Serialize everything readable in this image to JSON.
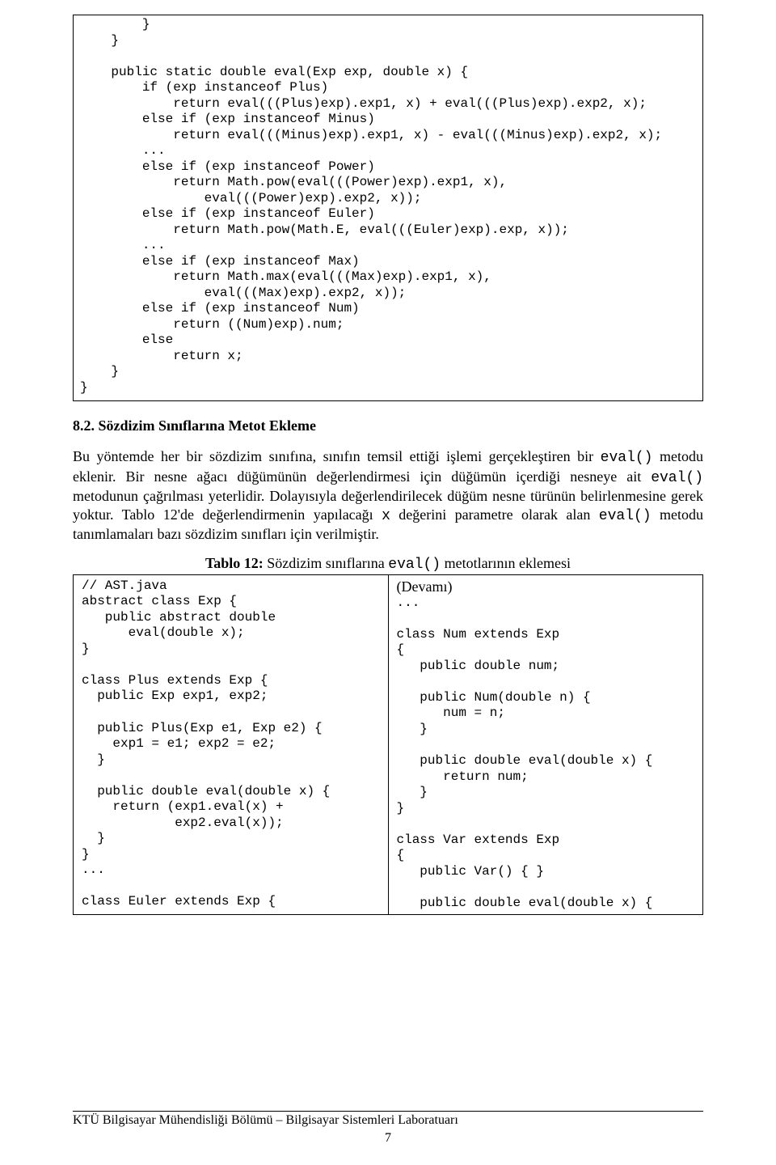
{
  "code_block_1": "        }\n    }\n\n    public static double eval(Exp exp, double x) {\n        if (exp instanceof Plus)\n            return eval(((Plus)exp).exp1, x) + eval(((Plus)exp).exp2, x);\n        else if (exp instanceof Minus)\n            return eval(((Minus)exp).exp1, x) - eval(((Minus)exp).exp2, x);\n        ...\n        else if (exp instanceof Power)\n            return Math.pow(eval(((Power)exp).exp1, x),\n                eval(((Power)exp).exp2, x));\n        else if (exp instanceof Euler)\n            return Math.pow(Math.E, eval(((Euler)exp).exp, x));\n        ...\n        else if (exp instanceof Max)\n            return Math.max(eval(((Max)exp).exp1, x),\n                eval(((Max)exp).exp2, x));\n        else if (exp instanceof Num)\n            return ((Num)exp).num;\n        else\n            return x;\n    }\n}",
  "section": {
    "number": "8.2.",
    "title": "Sözdizim Sınıflarına Metot Ekleme"
  },
  "paragraph": {
    "pre_eval1": "Bu yöntemde her bir sözdizim sınıfına, sınıfın temsil ettiği işlemi gerçekleştiren bir ",
    "eval1": "eval()",
    "mid1": " metodu eklenir. Bir nesne ağacı düğümünün değerlendirmesi için düğümün içerdiği nesneye ait ",
    "eval2": "eval()",
    "mid2": " metodunun çağrılması yeterlidir. Dolayısıyla değerlendirilecek düğüm nesne türünün belirlenmesine gerek yoktur. Tablo 12'de değerlendirmenin yapılacağı ",
    "x": "x",
    "mid3": " değerini parametre olarak alan ",
    "eval3": "eval()",
    "tail": " metodu tanımlamaları bazı sözdizim sınıfları için verilmiştir."
  },
  "table_caption": {
    "label": "Tablo 12:",
    "pre": " Sözdizim sınıflarına ",
    "mono": "eval()",
    "post": " metotlarının eklemesi"
  },
  "table": {
    "left": "// AST.java\nabstract class Exp {\n   public abstract double\n      eval(double x);\n}\n\nclass Plus extends Exp {\n  public Exp exp1, exp2;\n\n  public Plus(Exp e1, Exp e2) {\n    exp1 = e1; exp2 = e2;\n  }\n\n  public double eval(double x) {\n    return (exp1.eval(x) +\n            exp2.eval(x));\n  }\n}\n...\n\nclass Euler extends Exp {",
    "right_header": "(Devamı)",
    "right": "...\n\nclass Num extends Exp\n{\n   public double num;\n\n   public Num(double n) {\n      num = n;\n   }\n\n   public double eval(double x) {\n      return num;\n   }\n}\n\nclass Var extends Exp\n{\n   public Var() { }\n\n   public double eval(double x) {"
  },
  "footer": "KTÜ Bilgisayar Mühendisliği Bölümü – Bilgisayar Sistemleri Laboratuarı",
  "page_number": "7"
}
